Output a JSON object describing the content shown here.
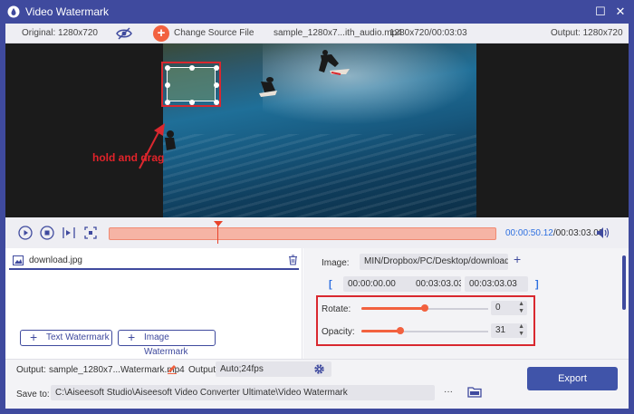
{
  "window": {
    "title": "Video Watermark",
    "maximize_glyph": "☐",
    "close_glyph": "✕"
  },
  "infobar": {
    "original": "Original: 1280x720",
    "change_source": "Change Source File",
    "filename": "sample_1280x7...ith_audio.mp4",
    "file_info": "1280x720/00:03:03",
    "output": "Output: 1280x720"
  },
  "preview": {
    "annotation": "hold and drag"
  },
  "timeline": {
    "current_time": "00:00:50.12",
    "total_time": "/00:03:03.03",
    "playhead_fraction": 0.28
  },
  "watermark_list": {
    "items": [
      {
        "name": "download.jpg"
      }
    ],
    "text_watermark_label": "Text Watermark",
    "image_watermark_label": "Image Watermark"
  },
  "settings": {
    "image_label": "Image:",
    "image_path": "MIN/Dropbox/PC/Desktop/download.jpg",
    "start_time": "00:00:00.00",
    "duration": "00:03:03.03",
    "end_time": "00:03:03.03",
    "rotate_label": "Rotate:",
    "rotate_value": "0",
    "rotate_fraction": 0.5,
    "opacity_label": "Opacity:",
    "opacity_value": "31",
    "opacity_fraction": 0.31
  },
  "bottom": {
    "output_label": "Output:",
    "output_file": "sample_1280x7...Watermark.mp4",
    "output_format_label": "Output:",
    "output_format": "Auto;24fps",
    "save_label": "Save to:",
    "save_path": "C:\\Aiseesoft Studio\\Aiseesoft Video Converter Ultimate\\Video Watermark",
    "more_glyph": "···",
    "export_label": "Export"
  },
  "colors": {
    "accent": "#f2613f",
    "frame": "#3f4a9e",
    "highlight": "#d9282f",
    "time_blue": "#2d6fe0"
  }
}
